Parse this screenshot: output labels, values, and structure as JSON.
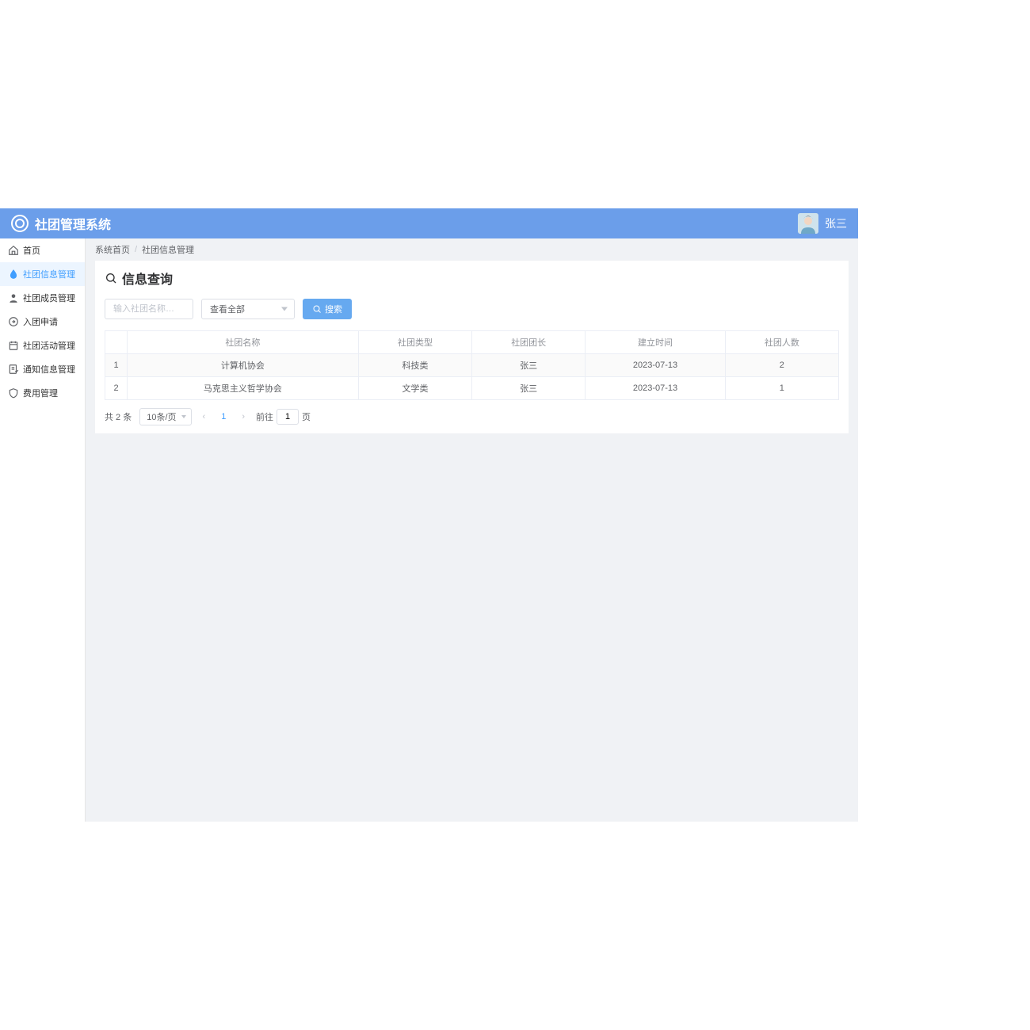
{
  "header": {
    "title": "社团管理系统",
    "username": "张三"
  },
  "sidebar": {
    "items": [
      {
        "label": "首页",
        "icon": "home",
        "active": false
      },
      {
        "label": "社团信息管理",
        "icon": "info-drop",
        "active": true
      },
      {
        "label": "社团成员管理",
        "icon": "person",
        "active": false
      },
      {
        "label": "入团申请",
        "icon": "arrow-circle",
        "active": false
      },
      {
        "label": "社团活动管理",
        "icon": "calendar",
        "active": false
      },
      {
        "label": "通知信息管理",
        "icon": "note-check",
        "active": false
      },
      {
        "label": "费用管理",
        "icon": "shield",
        "active": false
      }
    ]
  },
  "breadcrumb": {
    "home": "系统首页",
    "current": "社团信息管理"
  },
  "panel": {
    "title": "信息查询"
  },
  "filter": {
    "name_placeholder": "输入社团名称…",
    "select_value": "查看全部",
    "search_label": "搜索"
  },
  "table": {
    "headers": [
      "",
      "社团名称",
      "社团类型",
      "社团团长",
      "建立时间",
      "社团人数"
    ],
    "rows": [
      {
        "idx": "1",
        "name": "计算机协会",
        "type": "科技类",
        "leader": "张三",
        "date": "2023-07-13",
        "count": "2"
      },
      {
        "idx": "2",
        "name": "马克思主义哲学协会",
        "type": "文学类",
        "leader": "张三",
        "date": "2023-07-13",
        "count": "1"
      }
    ]
  },
  "pagination": {
    "total_text": "共 2 条",
    "page_size": "10条/页",
    "current": "1",
    "goto_prefix": "前往",
    "goto_value": "1",
    "goto_suffix": "页"
  }
}
